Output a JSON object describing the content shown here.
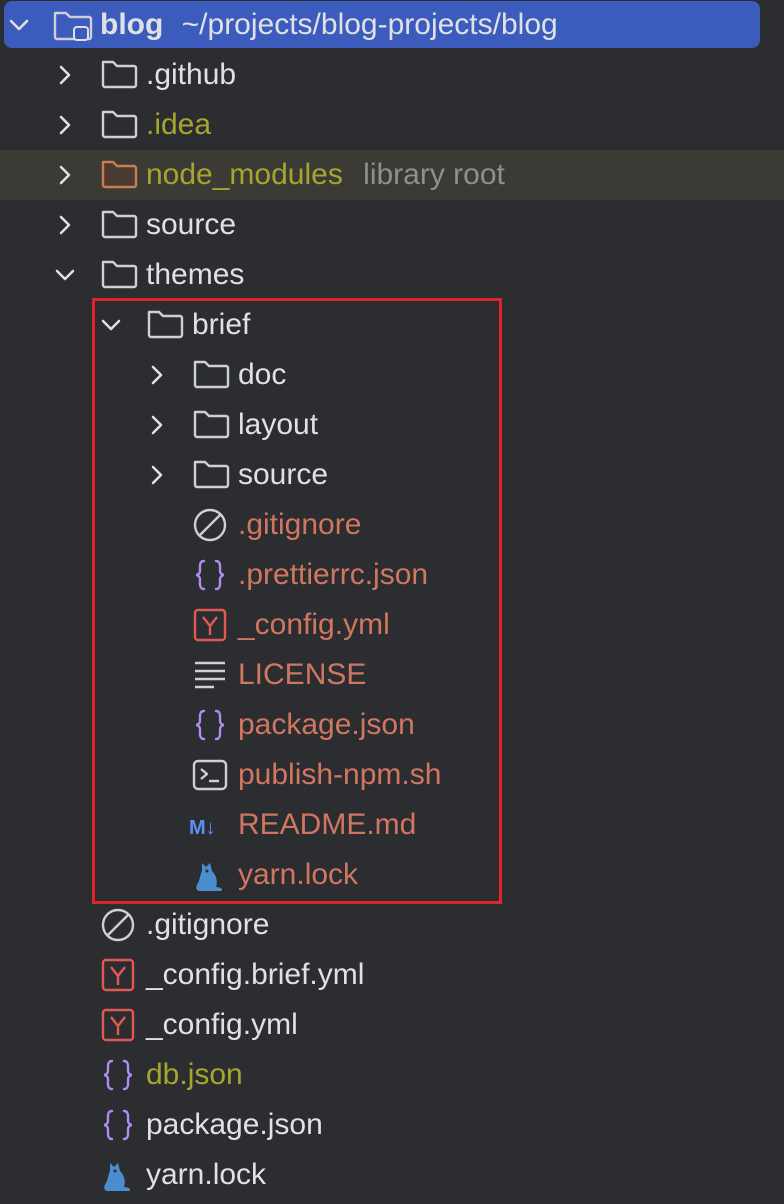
{
  "root": {
    "name": "blog",
    "path": "~/projects/blog-projects/blog",
    "icon": "project-folder-icon"
  },
  "items": [
    {
      "key": "github",
      "label": ".github",
      "icon": "folder-icon",
      "expanded": false
    },
    {
      "key": "idea",
      "label": ".idea",
      "icon": "folder-icon",
      "expanded": false
    },
    {
      "key": "node_modules",
      "label": "node_modules",
      "hint": "library root",
      "icon": "folder-icon",
      "expanded": false
    },
    {
      "key": "source",
      "label": "source",
      "icon": "folder-icon",
      "expanded": false
    },
    {
      "key": "themes",
      "label": "themes",
      "icon": "folder-icon",
      "expanded": true
    },
    {
      "key": "brief",
      "label": "brief",
      "icon": "folder-icon",
      "expanded": true
    },
    {
      "key": "brief_doc",
      "label": "doc",
      "icon": "folder-icon",
      "expanded": false
    },
    {
      "key": "brief_layout",
      "label": "layout",
      "icon": "folder-icon",
      "expanded": false
    },
    {
      "key": "brief_source",
      "label": "source",
      "icon": "folder-icon",
      "expanded": false
    },
    {
      "key": "brief_gitignore",
      "label": ".gitignore",
      "icon": "ignore-file-icon"
    },
    {
      "key": "brief_prettierrc",
      "label": ".prettierrc.json",
      "icon": "json-file-icon"
    },
    {
      "key": "brief_config",
      "label": "_config.yml",
      "icon": "yaml-file-icon"
    },
    {
      "key": "brief_license",
      "label": "LICENSE",
      "icon": "text-file-icon"
    },
    {
      "key": "brief_package",
      "label": "package.json",
      "icon": "json-file-icon"
    },
    {
      "key": "brief_publish",
      "label": "publish-npm.sh",
      "icon": "shell-script-icon"
    },
    {
      "key": "brief_readme",
      "label": "README.md",
      "icon": "markdown-file-icon",
      "icon_text": "M↓"
    },
    {
      "key": "brief_yarn",
      "label": "yarn.lock",
      "icon": "yarn-lock-icon"
    },
    {
      "key": "gitignore",
      "label": ".gitignore",
      "icon": "ignore-file-icon"
    },
    {
      "key": "config_brief",
      "label": "_config.brief.yml",
      "icon": "yaml-file-icon"
    },
    {
      "key": "config",
      "label": "_config.yml",
      "icon": "yaml-file-icon"
    },
    {
      "key": "db",
      "label": "db.json",
      "icon": "json-file-icon"
    },
    {
      "key": "package",
      "label": "package.json",
      "icon": "json-file-icon"
    },
    {
      "key": "yarn",
      "label": "yarn.lock",
      "icon": "yarn-lock-icon"
    }
  ],
  "colors": {
    "background": "#2b2d30",
    "selection": "#3b5bbd",
    "excluded_row": "#3c3a35",
    "text_default": "#dfe1e5",
    "text_ignored": "#a5a62e",
    "text_untracked": "#d07661",
    "text_hint": "#8c8f94",
    "highlight_box": "#e0242a",
    "folder_stroke": "#ced0d6",
    "excluded_folder": "#c57f53",
    "json_icon": "#b18cf0",
    "yaml_icon": "#e05a55",
    "markdown_icon": "#5b8ff0",
    "yarn_icon": "#4b8ed0"
  }
}
